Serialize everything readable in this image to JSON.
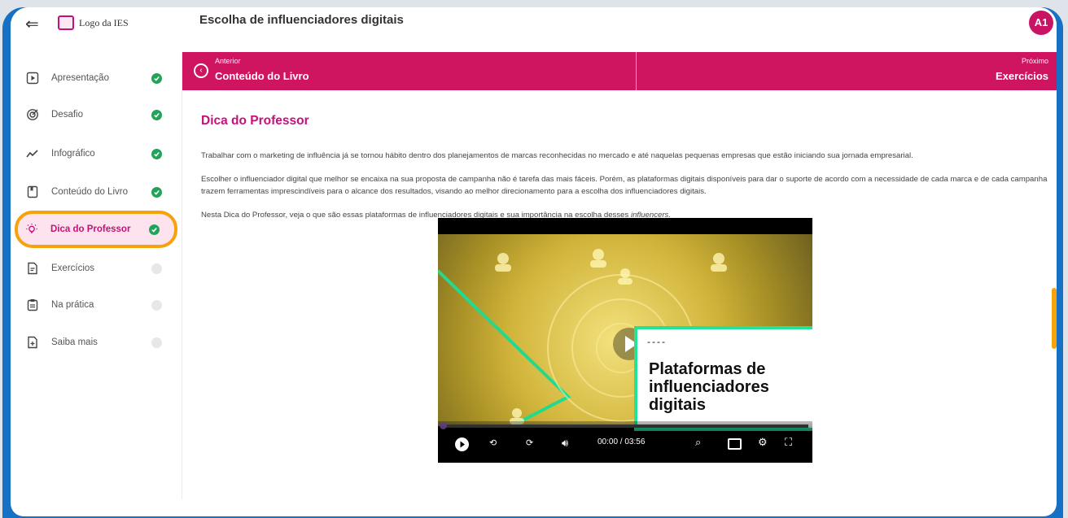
{
  "app": {
    "logo_text": "Logo da IES",
    "page_title": "Escolha de influenciadores digitais",
    "avatar_initials": "A1"
  },
  "sidebar": {
    "items": [
      {
        "label": "Apresentação",
        "icon": "play-square-icon",
        "status": "done"
      },
      {
        "label": "Desafio",
        "icon": "target-icon",
        "status": "done"
      },
      {
        "label": "Infográfico",
        "icon": "trend-line-icon",
        "status": "done"
      },
      {
        "label": "Conteúdo do Livro",
        "icon": "bookmark-icon",
        "status": "done"
      },
      {
        "label": "Dica do Professor",
        "icon": "lightbulb-icon",
        "status": "done",
        "active": true
      },
      {
        "label": "Exercícios",
        "icon": "document-icon",
        "status": "pending"
      },
      {
        "label": "Na prática",
        "icon": "clipboard-icon",
        "status": "pending"
      },
      {
        "label": "Saiba mais",
        "icon": "doc-plus-icon",
        "status": "pending"
      }
    ]
  },
  "nav": {
    "prev_small": "Anterior",
    "prev_big": "Conteúdo do Livro",
    "next_small": "Próximo",
    "next_big": "Exercícios"
  },
  "main": {
    "section_title": "Dica do Professor",
    "paragraphs": [
      "Trabalhar com o marketing de influência já se tornou hábito dentro dos planejamentos de marcas reconhecidas no mercado e até naquelas pequenas empresas que estão iniciando sua jornada empresarial.",
      "Escolher o influenciador digital que melhor se encaixa na sua proposta de campanha não é tarefa das mais fáceis. Porém, as plataformas digitais disponíveis para dar o suporte de acordo com a necessidade de cada marca e de cada campanha trazem ferramentas imprescindíveis para o alcance dos resultados, visando ao melhor direcionamento para a escolha dos influenciadores digitais.",
      "Nesta Dica do Professor, veja o que são essas plataformas de influenciadores digitais e sua importância na escolha desses "
    ],
    "paragraph3_italic": "influencers."
  },
  "video": {
    "card_dash": "----",
    "card_title_lines": [
      "Plataformas de",
      "influenciadores",
      "digitais"
    ],
    "time": "00:00 / 03:56"
  },
  "colors": {
    "accent": "#cf1460",
    "highlight_outline": "#f5a20b",
    "success": "#22a35a",
    "device_frame": "#1670c4"
  }
}
